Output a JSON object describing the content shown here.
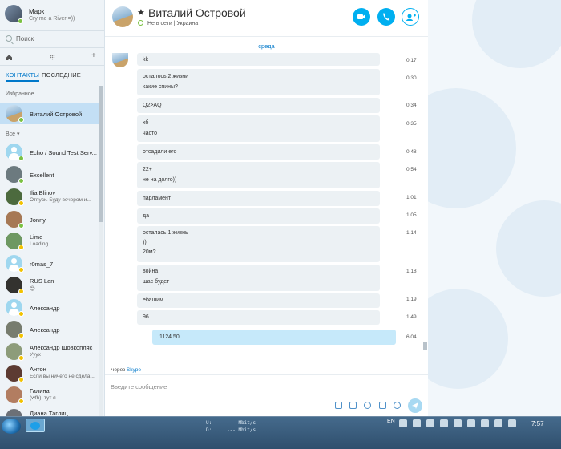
{
  "profile": {
    "name": "Марк",
    "mood": "Cry me a River =))"
  },
  "search": {
    "label": "Поиск"
  },
  "tabs": {
    "contacts": "КОНТАКТЫ",
    "recent": "ПОСЛЕДНИЕ"
  },
  "sidebar_actions": {
    "plus": "+"
  },
  "sections": {
    "favorites": "Избранное",
    "all": "Все ▾"
  },
  "favorite": {
    "name": "Виталий Островой"
  },
  "contacts": [
    {
      "name": "Echo / Sound Test Serv...",
      "mood": "",
      "status": "online"
    },
    {
      "name": "Excellent",
      "mood": "",
      "status": "online"
    },
    {
      "name": "Ilia Blinov",
      "mood": "Отпуск. Буду вечером и...",
      "status": "away"
    },
    {
      "name": "Jonny",
      "mood": "",
      "status": "online"
    },
    {
      "name": "Lime",
      "mood": "Loading...",
      "status": "away"
    },
    {
      "name": "r0mas_7",
      "mood": "",
      "status": "away"
    },
    {
      "name": "RUS Lan",
      "mood": "😊",
      "status": "away"
    },
    {
      "name": "Александр",
      "mood": "",
      "status": "away"
    },
    {
      "name": "Александр",
      "mood": "",
      "status": "away"
    },
    {
      "name": "Александр Шовкопляс",
      "mood": "Ууух",
      "status": "away"
    },
    {
      "name": "Антон",
      "mood": "Если вы ничего не сдела...",
      "status": "away"
    },
    {
      "name": "Галина",
      "mood": "(wfh), тут я",
      "status": "away"
    },
    {
      "name": "Диана Таглиц",
      "mood": "",
      "status": "away"
    }
  ],
  "chat": {
    "star": "★",
    "peer_name": "Виталий Островой",
    "peer_status": "Не в сети  |  Украина",
    "day_separator": "среда",
    "messages": [
      {
        "lines": [
          "kk"
        ],
        "time": "0:17"
      },
      {
        "lines": [
          "осталось 2 жизни",
          "какие спины?"
        ],
        "time": "0:30"
      },
      {
        "lines": [
          "Q2>AQ"
        ],
        "time": "0:34"
      },
      {
        "lines": [
          "хб",
          "часто"
        ],
        "time": "0:35"
      },
      {
        "lines": [
          "отсадили его"
        ],
        "time": "0:48"
      },
      {
        "lines": [
          "22+",
          "не на долго))"
        ],
        "time": "0:54"
      },
      {
        "lines": [
          "парламент"
        ],
        "time": "1:01"
      },
      {
        "lines": [
          "да"
        ],
        "time": "1:05"
      },
      {
        "lines": [
          "осталась 1 жизнь",
          "))",
          "20м?"
        ],
        "time": "1:14"
      },
      {
        "lines": [
          "война",
          "щас будет"
        ],
        "time": "1:18"
      },
      {
        "lines": [
          "ебашим"
        ],
        "time": "1:19"
      },
      {
        "lines": [
          "96"
        ],
        "time": "1:49"
      }
    ],
    "outgoing": {
      "text": "1124.50",
      "time": "6:04"
    },
    "via_prefix": "через ",
    "via_app": "Skype",
    "composer_placeholder": "Введите сообщение"
  },
  "taskbar": {
    "net_up_label": "U:",
    "net_down_label": "D:",
    "net_up_value": "--- Mbit/s",
    "net_down_value": "--- Mbit/s",
    "language": "EN",
    "clock": "7:57"
  },
  "colors": {
    "accent": "#00aff0",
    "link": "#0078ca",
    "online": "#7ac142",
    "away": "#f2c200",
    "selected": "#c3dff5",
    "incoming_bubble": "#ecf1f4",
    "outgoing_bubble": "#c6e9fa"
  }
}
